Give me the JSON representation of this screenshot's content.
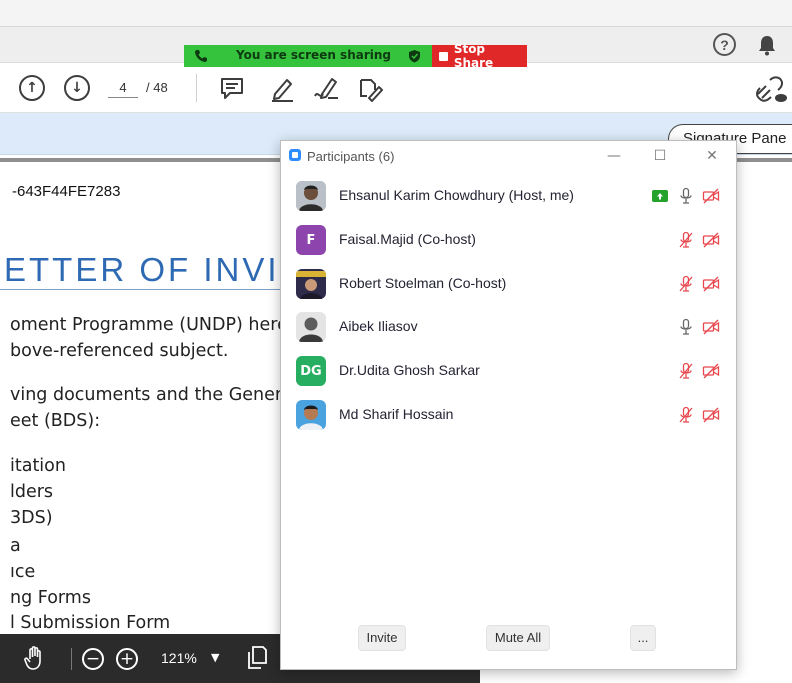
{
  "screen_share": {
    "status_text": "You are screen sharing",
    "stop_label": "Stop Share"
  },
  "pdf_toolbar": {
    "current_page": "4",
    "total_pages": "/ 48"
  },
  "signature_panel": {
    "label": "Signature Pane"
  },
  "document": {
    "id_text": "-643F44FE7283",
    "heading": "ETTER OF INVITA",
    "lines": [
      "oment Programme (UNDP) here",
      "bove-referenced subject.",
      "ving documents and the Genera",
      "eet (BDS):",
      "itation",
      "lders",
      "3DS)",
      "a",
      "ıce",
      "ng Forms",
      "l Submission Form"
    ]
  },
  "bottom_toolbar": {
    "zoom": "121%"
  },
  "participants_panel": {
    "title": "Participants (6)",
    "participants": [
      {
        "name": "Ehsanul Karim Chowdhury (Host, me)",
        "avatar": "photo",
        "sharing": true,
        "mic": "on",
        "video": "off"
      },
      {
        "name": "Faisal.Majid (Co-host)",
        "avatar": "F",
        "avatar_color": "#8e44ad",
        "mic": "muted",
        "video": "off"
      },
      {
        "name": "Robert Stoelman (Co-host)",
        "avatar": "photo",
        "mic": "muted",
        "video": "off"
      },
      {
        "name": "Aibek Iliasov",
        "avatar": "photo",
        "mic": "on",
        "video": "off"
      },
      {
        "name": "Dr.Udita Ghosh Sarkar",
        "avatar": "DG",
        "avatar_color": "#27ae60",
        "mic": "muted",
        "video": "off"
      },
      {
        "name": "Md Sharif Hossain",
        "avatar": "photo",
        "mic": "muted",
        "video": "off"
      }
    ],
    "footer": {
      "invite": "Invite",
      "mute_all": "Mute All",
      "more": "..."
    }
  },
  "colors": {
    "share_green": "#35c23c",
    "stop_red": "#e02828",
    "muted_red": "#e8474e",
    "zoom_blue": "#2d8cff"
  }
}
